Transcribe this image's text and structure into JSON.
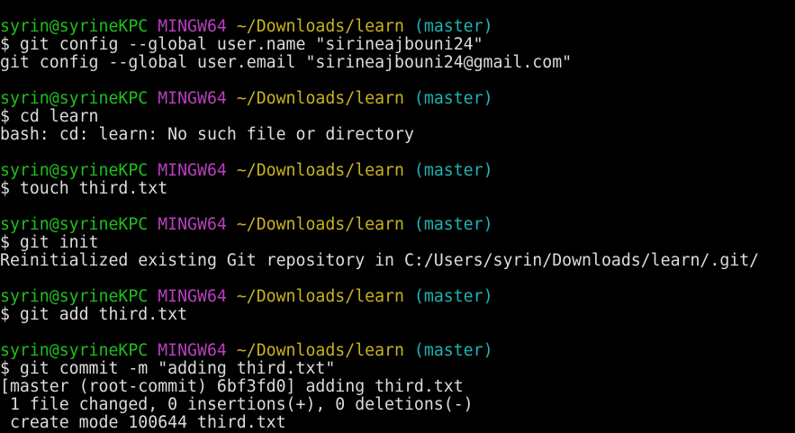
{
  "prompt": {
    "user_host": "syrin@syrineKPC",
    "shell": "MINGW64",
    "path": "~/Downloads/learn",
    "branch": "(master)"
  },
  "blocks": [
    {
      "command": "$ git config --global user.name \"sirineajbouni24\"",
      "output": [
        "git config --global user.email \"sirineajbouni24@gmail.com\""
      ]
    },
    {
      "command": "$ cd learn",
      "output": [
        "bash: cd: learn: No such file or directory"
      ]
    },
    {
      "command": "$ touch third.txt",
      "output": []
    },
    {
      "command": "$ git init",
      "output": [
        "Reinitialized existing Git repository in C:/Users/syrin/Downloads/learn/.git/"
      ]
    },
    {
      "command": "$ git add third.txt",
      "output": []
    },
    {
      "command": "$ git commit -m \"adding third.txt\"",
      "output": [
        "[master (root-commit) 6bf3fd0] adding third.txt",
        " 1 file changed, 0 insertions(+), 0 deletions(-)",
        " create mode 100644 third.txt"
      ]
    }
  ]
}
